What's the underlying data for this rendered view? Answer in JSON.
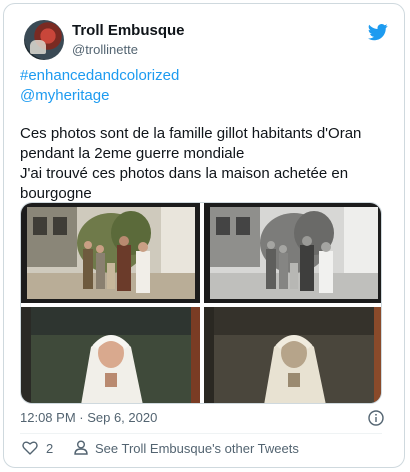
{
  "author": {
    "display_name": "Troll Embusque",
    "handle": "@trollinette",
    "avatar_icon": "profile-photo"
  },
  "brand": {
    "icon": "twitter-bird-icon",
    "color": "#1d9bf0"
  },
  "tweet": {
    "hashtag": "#enhancedandcolorized",
    "mention": "@myheritage",
    "lines": [
      "Ces photos sont de la famille gillot habitants d'Oran",
      "pendant la 2eme guerre mondiale",
      "J'ai trouvé ces photos dans la maison achetée en",
      "bourgogne"
    ],
    "media_count": 4
  },
  "footer": {
    "timestamp": "12:08 PM · Sep 6, 2020",
    "like_count": "2",
    "other_tweets_link": "See Troll Embusque's other Tweets"
  },
  "colors": {
    "link": "#1d9bf0",
    "muted": "#536471",
    "border": "#cfd9de"
  }
}
